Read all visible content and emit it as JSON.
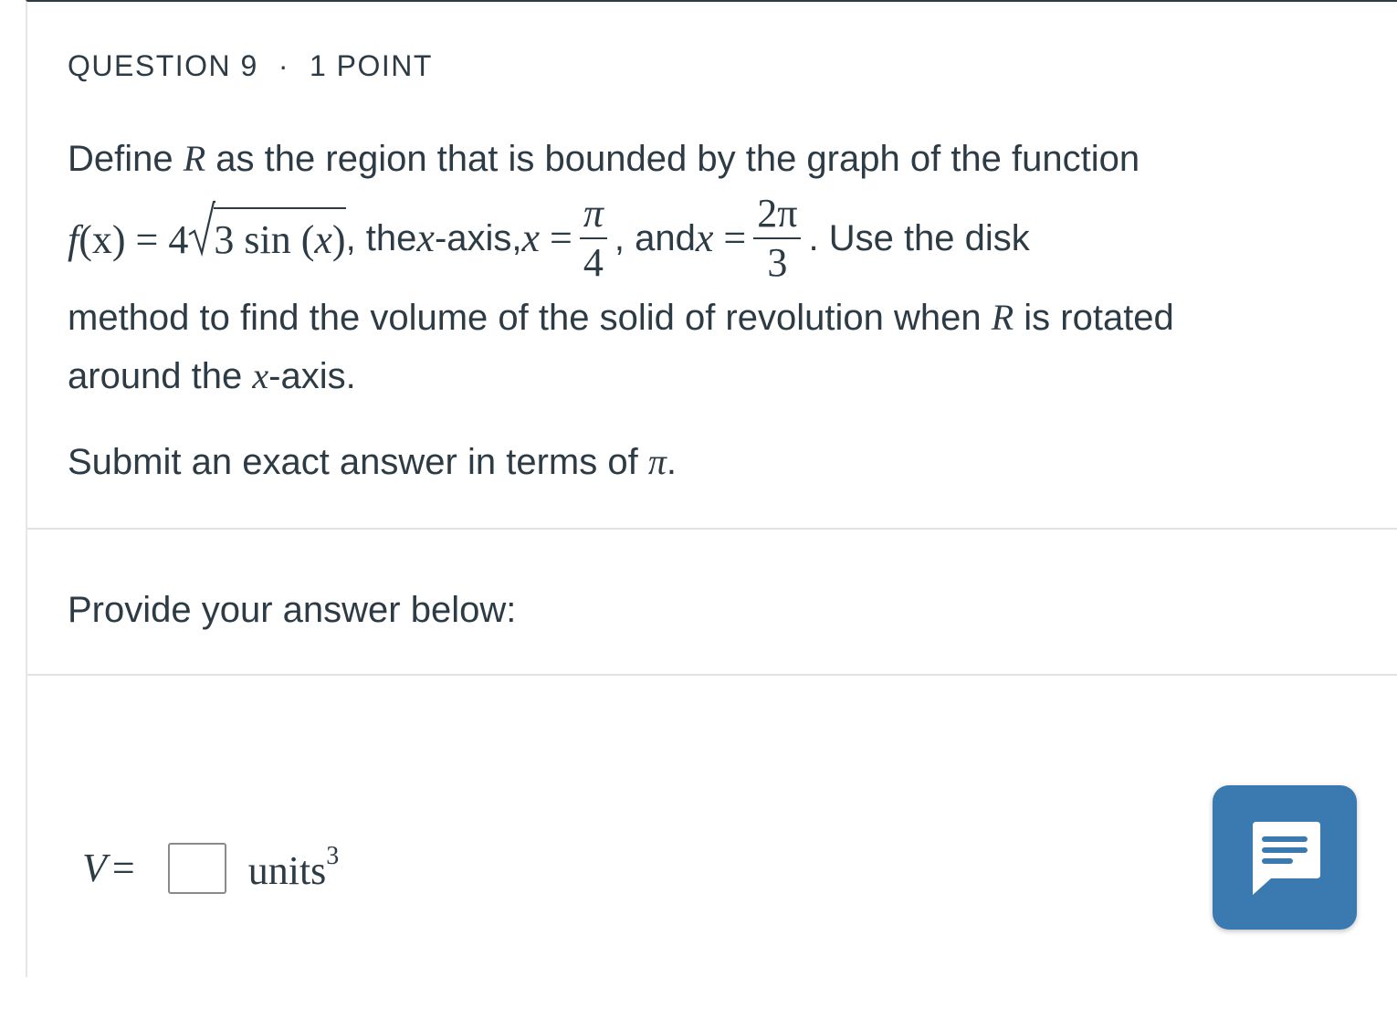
{
  "question": {
    "number_label": "QUESTION 9",
    "separator": "·",
    "points_label": "1 POINT"
  },
  "prompt": {
    "line1_text": "Define ",
    "line1_var": "R",
    "line1_rest": " as the region that is bounded by the graph of the function",
    "func_name": "f",
    "func_arg": "(x)",
    "func_eq": " = 4",
    "sqrt_content_num": "3 sin (",
    "sqrt_content_var": "x",
    "sqrt_content_close": ")",
    "after_func": ", the ",
    "x_axis_var": "x",
    "x_axis_text": "-axis, ",
    "bound1_var": "x",
    "bound1_eq": " =",
    "bound1_num": "π",
    "bound1_den": "4",
    "between": ", and ",
    "bound2_var": "x",
    "bound2_eq": " =",
    "bound2_num": "2π",
    "bound2_den": "3",
    "after_bounds": ". Use the disk",
    "line3_text": "method to find the volume of the solid of revolution when ",
    "line3_var": "R",
    "line3_rest": " is rotated",
    "line4_text": "around the ",
    "line4_var": "x",
    "line4_rest": "-axis.",
    "submit_text": "Submit an exact answer in terms of ",
    "submit_var": "π",
    "submit_end": "."
  },
  "answer_section": {
    "heading": "Provide your answer below:",
    "var_label": "V",
    "equals": "=",
    "input_value": "",
    "units_label": "units",
    "units_exponent": "3"
  },
  "chat_button": {
    "icon": "chat-icon",
    "color": "#3a7ab0"
  }
}
